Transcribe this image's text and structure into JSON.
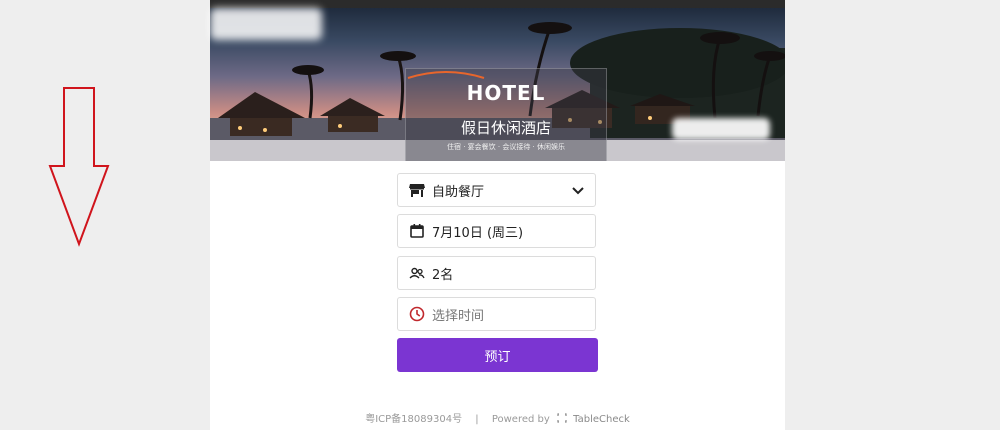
{
  "hero": {
    "logo_text": "HOTEL",
    "hotel_name": "假日休闲酒店",
    "tags": "住宿 · 宴会餐饮 · 会议接待 · 休闲娱乐"
  },
  "form": {
    "venue": {
      "value": "自助餐厅",
      "icon": "store-icon"
    },
    "date": {
      "value": "7月10日 (周三)",
      "icon": "calendar-icon"
    },
    "guests": {
      "value": "2名",
      "icon": "people-icon"
    },
    "time": {
      "placeholder": "选择时间",
      "icon": "clock-icon"
    },
    "reserve_label": "预订"
  },
  "footer": {
    "icp": "粤ICP备18089304号",
    "separator": "|",
    "powered_by": "Powered by",
    "brand": "TableCheck"
  },
  "colors": {
    "accent": "#7b35d2",
    "clock_icon": "#c0282d",
    "annotation_arrow": "#d0141c"
  }
}
